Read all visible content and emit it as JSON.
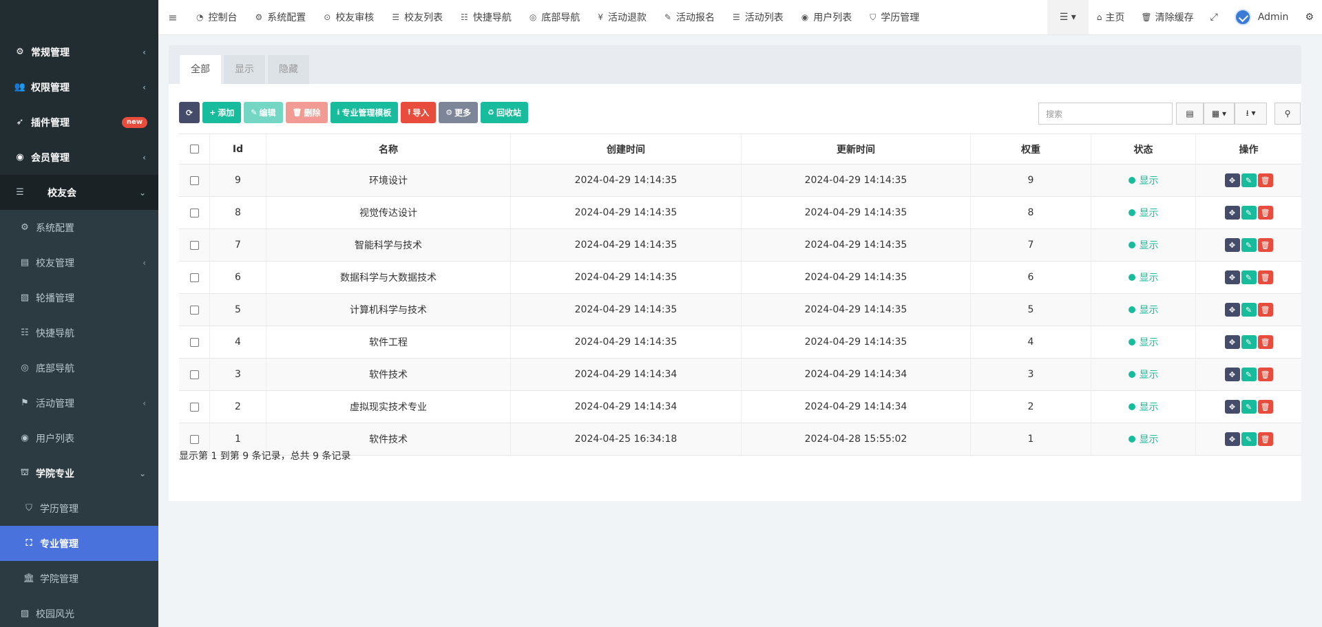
{
  "sidebar": {
    "items": [
      {
        "label": "常规管理",
        "icon": "cogs-icon",
        "glyph": "⚙",
        "arrow": "‹"
      },
      {
        "label": "权限管理",
        "icon": "group-icon",
        "glyph": "👥",
        "arrow": "‹"
      },
      {
        "label": "插件管理",
        "icon": "rocket-icon",
        "glyph": "➶",
        "badge": "new"
      },
      {
        "label": "会员管理",
        "icon": "user-circle-icon",
        "glyph": "◉",
        "arrow": "‹"
      },
      {
        "label": "校友会",
        "icon": "list-icon",
        "glyph": "☰",
        "arrow": "⌄"
      },
      {
        "label": "系统配置",
        "icon": "gear-icon",
        "glyph": "⚙"
      },
      {
        "label": "校友管理",
        "icon": "id-card-icon",
        "glyph": "▤",
        "arrow": "‹"
      },
      {
        "label": "轮播管理",
        "icon": "image-icon",
        "glyph": "▨"
      },
      {
        "label": "快捷导航",
        "icon": "list-ul-icon",
        "glyph": "☷"
      },
      {
        "label": "底部导航",
        "icon": "chrome-icon",
        "glyph": "◎"
      },
      {
        "label": "活动管理",
        "icon": "flag-icon",
        "glyph": "⚑",
        "arrow": "‹"
      },
      {
        "label": "用户列表",
        "icon": "user-icon",
        "glyph": "◉"
      },
      {
        "label": "学院专业",
        "icon": "university-icon",
        "glyph": "⛫",
        "arrow": "⌄"
      },
      {
        "label": "学历管理",
        "icon": "tags-icon",
        "glyph": "⛉"
      },
      {
        "label": "专业管理",
        "icon": "sitemap-icon",
        "glyph": "⛶"
      },
      {
        "label": "学院管理",
        "icon": "bank-icon",
        "glyph": "🏛"
      },
      {
        "label": "校园风光",
        "icon": "image-icon",
        "glyph": "▨"
      }
    ]
  },
  "navbar": {
    "toggle_glyph": "≡",
    "tabs": [
      {
        "label": "控制台",
        "glyph": "◔"
      },
      {
        "label": "系统配置",
        "glyph": "⚙"
      },
      {
        "label": "校友审核",
        "glyph": "⊙"
      },
      {
        "label": "校友列表",
        "glyph": "☰"
      },
      {
        "label": "快捷导航",
        "glyph": "☷"
      },
      {
        "label": "底部导航",
        "glyph": "◎"
      },
      {
        "label": "活动退款",
        "glyph": "¥"
      },
      {
        "label": "活动报名",
        "glyph": "✎"
      },
      {
        "label": "活动列表",
        "glyph": "☰"
      },
      {
        "label": "用户列表",
        "glyph": "◉"
      },
      {
        "label": "学历管理",
        "glyph": "⛉"
      }
    ],
    "menu_toggle": "☰ ▾",
    "home_label": "主页",
    "home_glyph": "⌂",
    "clear_cache_label": "清除缓存",
    "clear_cache_glyph": "🗑",
    "fullscreen_glyph": "⤢",
    "user_label": "Admin",
    "settings_glyph": "⚙"
  },
  "tabs": [
    {
      "label": "全部",
      "active": true
    },
    {
      "label": "显示",
      "active": false
    },
    {
      "label": "隐藏",
      "active": false
    }
  ],
  "toolbar": {
    "refresh_glyph": "⟳",
    "add_label": "添加",
    "add_glyph": "+",
    "edit_label": "编辑",
    "edit_glyph": "✎",
    "delete_label": "删除",
    "delete_glyph": "🗑",
    "template_label": "专业管理模板",
    "template_glyph": "⭳",
    "import_label": "导入",
    "import_glyph": "⭱",
    "more_label": "更多",
    "more_glyph": "⚙",
    "recycle_label": "回收站",
    "recycle_glyph": "♻"
  },
  "search": {
    "placeholder": "搜索"
  },
  "table_tools": {
    "toggle_view_glyph": "▤",
    "columns_glyph": "▦ ▾",
    "export_glyph": "⭳ ▾",
    "search_glyph": "⚲"
  },
  "table": {
    "headers": [
      "Id",
      "名称",
      "创建时间",
      "更新时间",
      "权重",
      "状态",
      "操作"
    ],
    "rows": [
      {
        "id": "9",
        "name": "环境设计",
        "created": "2024-04-29 14:14:35",
        "updated": "2024-04-29 14:14:35",
        "weight": "9",
        "status": "显示"
      },
      {
        "id": "8",
        "name": "视觉传达设计",
        "created": "2024-04-29 14:14:35",
        "updated": "2024-04-29 14:14:35",
        "weight": "8",
        "status": "显示"
      },
      {
        "id": "7",
        "name": "智能科学与技术",
        "created": "2024-04-29 14:14:35",
        "updated": "2024-04-29 14:14:35",
        "weight": "7",
        "status": "显示"
      },
      {
        "id": "6",
        "name": "数据科学与大数据技术",
        "created": "2024-04-29 14:14:35",
        "updated": "2024-04-29 14:14:35",
        "weight": "6",
        "status": "显示"
      },
      {
        "id": "5",
        "name": "计算机科学与技术",
        "created": "2024-04-29 14:14:35",
        "updated": "2024-04-29 14:14:35",
        "weight": "5",
        "status": "显示"
      },
      {
        "id": "4",
        "name": "软件工程",
        "created": "2024-04-29 14:14:35",
        "updated": "2024-04-29 14:14:35",
        "weight": "4",
        "status": "显示"
      },
      {
        "id": "3",
        "name": "软件技术",
        "created": "2024-04-29 14:14:34",
        "updated": "2024-04-29 14:14:34",
        "weight": "3",
        "status": "显示"
      },
      {
        "id": "2",
        "name": "虚拟现实技术专业",
        "created": "2024-04-29 14:14:34",
        "updated": "2024-04-29 14:14:34",
        "weight": "2",
        "status": "显示"
      },
      {
        "id": "1",
        "name": "软件技术",
        "created": "2024-04-25 16:34:18",
        "updated": "2024-04-28 15:55:02",
        "weight": "1",
        "status": "显示"
      }
    ],
    "op_glyphs": {
      "drag": "✥",
      "edit": "✎",
      "delete": "🗑"
    }
  },
  "pagination": {
    "summary": "显示第 1 到第 9 条记录，总共 9 条记录"
  },
  "colors": {
    "sidebar_bg": "#222d32",
    "active_menu": "#4a72dd",
    "success": "#18bc9c",
    "danger": "#e74c3c",
    "dark_btn": "#444c69"
  }
}
